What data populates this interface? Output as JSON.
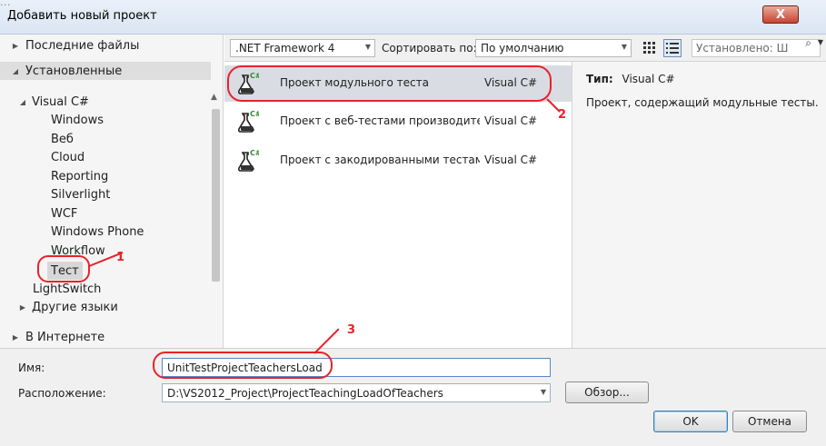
{
  "window": {
    "background_title_text": "...",
    "title": "Добавить новый проект",
    "close_glyph": "X"
  },
  "left_panel": {
    "recent": "Последние файлы",
    "installed": "Установленные",
    "visual_csharp": "Visual C#",
    "children": [
      "Windows",
      "Веб",
      "Cloud",
      "Reporting",
      "Silverlight",
      "WCF",
      "Windows Phone",
      "Workflow",
      "Тест"
    ],
    "lightswitch": "LightSwitch",
    "other_languages": "Другие языки",
    "online": "В Интернете",
    "selected_child": "Тест"
  },
  "toolbar": {
    "framework": ".NET Framework 4",
    "sort_label": "Сортировать по:",
    "sort_value": "По умолчанию",
    "search_placeholder": "Установлено: Ш"
  },
  "templates": [
    {
      "name": "Проект модульного теста",
      "lang": "Visual C#",
      "selected": true
    },
    {
      "name": "Проект с веб-тестами производите...",
      "lang": "Visual C#",
      "selected": false
    },
    {
      "name": "Проект с закодированными тестам...",
      "lang": "Visual C#",
      "selected": false
    }
  ],
  "details": {
    "type_label": "Тип:",
    "type_value": "Visual C#",
    "description": "Проект, содержащий модульные тесты."
  },
  "form": {
    "name_label": "Имя:",
    "name_value": "UnitTestProjectTeachersLoad",
    "location_label": "Расположение:",
    "location_value": "D:\\VS2012_Project\\ProjectTeachingLoadOfTeachers",
    "browse": "Обзор...",
    "ok": "OK",
    "cancel": "Отмена"
  },
  "annotations": {
    "marker_1": "1",
    "marker_2": "2",
    "marker_3": "3",
    "color": "#e8222a"
  },
  "icons": {
    "template_icon": "flask-csharp-icon",
    "search": "search-icon",
    "grid_view": "grid-view-icon",
    "list_view": "list-view-icon"
  },
  "colors": {
    "selection": "#d9dde3",
    "close_button": "#c7442f",
    "csharp_badge": "#2e8b2e"
  }
}
